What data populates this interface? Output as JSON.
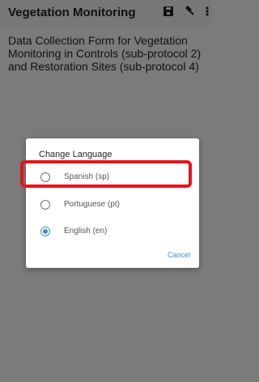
{
  "app_bar": {
    "title": "Vegetation Monitoring",
    "icons": [
      "save-icon",
      "pin-icon",
      "more-vert-icon"
    ]
  },
  "form_title": "Data Collection Form for Vegetation Monitoring in Controls (sub-protocol 2) and Restoration Sites (sub-protocol 4)",
  "dialog": {
    "title": "Change Language",
    "options": [
      {
        "label": "Spanish (sp)",
        "selected": false
      },
      {
        "label": "Portuguese (pt)",
        "selected": false
      },
      {
        "label": "English (en)",
        "selected": true
      }
    ],
    "cancel_label": "Cancel"
  },
  "colors": {
    "accent": "#3a8fdc",
    "highlight": "#e5141c",
    "scrim_background": "#7b7b7b"
  }
}
